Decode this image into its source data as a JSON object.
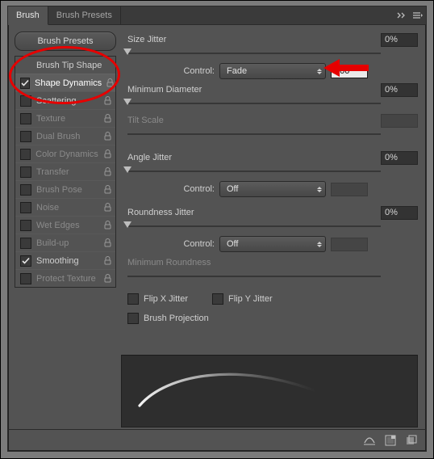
{
  "tabs": {
    "main": "Brush",
    "secondary": "Brush Presets"
  },
  "sidebar": {
    "presets_button": "Brush Presets",
    "items": [
      {
        "label": "Brush Tip Shape",
        "checkbox": false,
        "lock": false,
        "header": true
      },
      {
        "label": "Shape Dynamics",
        "checked": true,
        "lock": true,
        "active": true
      },
      {
        "label": "Scattering",
        "checked": false,
        "lock": true
      },
      {
        "label": "Texture",
        "checked": false,
        "lock": true,
        "dim": true
      },
      {
        "label": "Dual Brush",
        "checked": false,
        "lock": true,
        "dim": true
      },
      {
        "label": "Color Dynamics",
        "checked": false,
        "lock": true,
        "dim": true
      },
      {
        "label": "Transfer",
        "checked": false,
        "lock": true,
        "dim": true
      },
      {
        "label": "Brush Pose",
        "checked": false,
        "lock": true,
        "dim": true
      },
      {
        "label": "Noise",
        "checked": false,
        "lock": true,
        "dim": true
      },
      {
        "label": "Wet Edges",
        "checked": false,
        "lock": true,
        "dim": true
      },
      {
        "label": "Build-up",
        "checked": false,
        "lock": true,
        "dim": true
      },
      {
        "label": "Smoothing",
        "checked": true,
        "lock": true
      },
      {
        "label": "Protect Texture",
        "checked": false,
        "lock": true,
        "dim": true
      }
    ]
  },
  "props": {
    "size_jitter": {
      "label": "Size Jitter",
      "value": "0%",
      "slider": 0
    },
    "control1": {
      "label": "Control:",
      "select": "Fade",
      "value": "200"
    },
    "min_diameter": {
      "label": "Minimum Diameter",
      "value": "0%",
      "slider": 0
    },
    "tilt_scale": {
      "label": "Tilt Scale",
      "value": "",
      "dim": true,
      "slider": 0
    },
    "angle_jitter": {
      "label": "Angle Jitter",
      "value": "0%",
      "slider": 0
    },
    "control2": {
      "label": "Control:",
      "select": "Off",
      "value": ""
    },
    "roundness_jitter": {
      "label": "Roundness Jitter",
      "value": "0%",
      "slider": 0
    },
    "control3": {
      "label": "Control:",
      "select": "Off",
      "value": ""
    },
    "min_roundness": {
      "label": "Minimum Roundness",
      "dim": true
    },
    "flip_x": {
      "label": "Flip X Jitter",
      "checked": false
    },
    "flip_y": {
      "label": "Flip Y Jitter",
      "checked": false
    },
    "brush_projection": {
      "label": "Brush Projection",
      "checked": false
    }
  }
}
